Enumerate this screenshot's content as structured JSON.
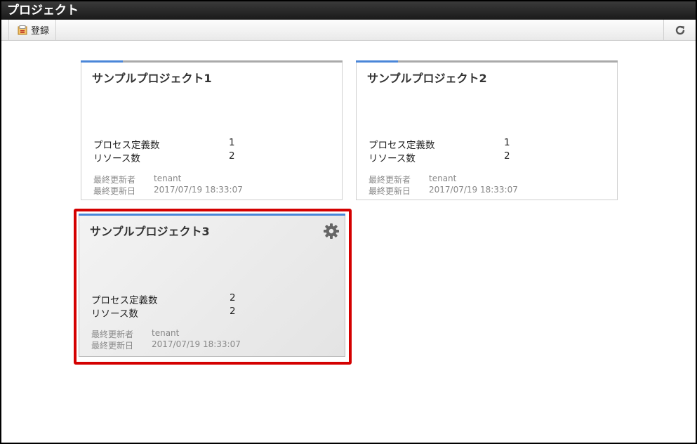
{
  "window": {
    "title": "プロジェクト"
  },
  "toolbar": {
    "register_label": "登録",
    "register_icon": "register-icon",
    "refresh_icon": "refresh-icon"
  },
  "projects": [
    {
      "title": "サンプルプロジェクト1",
      "process_label": "プロセス定義数",
      "process_count": "1",
      "resource_label": "リソース数",
      "resource_count": "2",
      "updated_by_label": "最終更新者",
      "updated_by": "tenant",
      "updated_at_label": "最終更新日",
      "updated_at": "2017/07/19 18:33:07"
    },
    {
      "title": "サンプルプロジェクト2",
      "process_label": "プロセス定義数",
      "process_count": "1",
      "resource_label": "リソース数",
      "resource_count": "2",
      "updated_by_label": "最終更新者",
      "updated_by": "tenant",
      "updated_at_label": "最終更新日",
      "updated_at": "2017/07/19 18:33:07"
    },
    {
      "title": "サンプルプロジェクト3",
      "process_label": "プロセス定義数",
      "process_count": "2",
      "resource_label": "リソース数",
      "resource_count": "2",
      "updated_by_label": "最終更新者",
      "updated_by": "tenant",
      "updated_at_label": "最終更新日",
      "updated_at": "2017/07/19 18:33:07",
      "settings_icon": "gear-icon"
    }
  ],
  "colors": {
    "accent": "#4a86d8",
    "highlight": "#d40000",
    "titlebar": "#222222"
  }
}
